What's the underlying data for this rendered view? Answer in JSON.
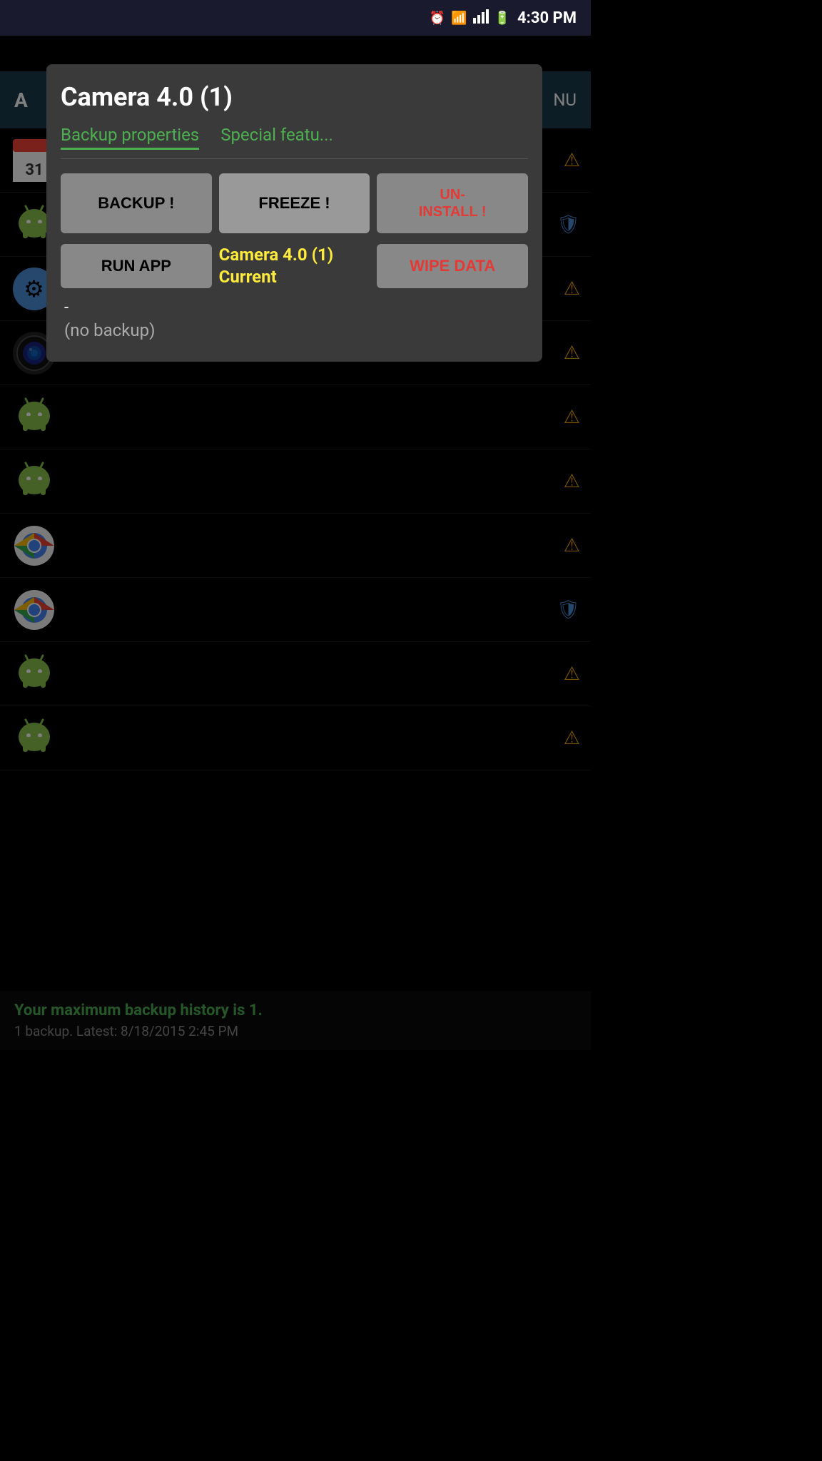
{
  "statusBar": {
    "time": "4:30 PM",
    "icons": [
      "alarm",
      "wifi",
      "signal",
      "battery"
    ]
  },
  "topBar": {
    "leftLabel": "A",
    "rightLabel": "NU"
  },
  "modal": {
    "title": "Camera 4.0 (1)",
    "tabs": [
      {
        "label": "Backup properties",
        "active": true
      },
      {
        "label": "Special featu...",
        "active": false
      }
    ],
    "buttons": {
      "backup": "BACKUP !",
      "freeze": "FREEZE !",
      "uninstall": "UN-\nINSTALL !",
      "runApp": "RUN APP",
      "wipeData": "WIPE DATA"
    },
    "appInfo": {
      "currentLabel": "Camera 4.0 (1)",
      "currentSublabel": "Current"
    },
    "backupInfo": {
      "dash": "-",
      "status": "(no backup)"
    }
  },
  "appList": {
    "rows": [
      {
        "iconType": "calendar",
        "warning": true
      },
      {
        "iconType": "android-green",
        "warning": false,
        "shield": true
      },
      {
        "iconType": "gear",
        "warning": true
      },
      {
        "iconType": "camera-lens",
        "warning": true
      },
      {
        "iconType": "android-green",
        "warning": true
      },
      {
        "iconType": "android-green",
        "warning": true
      },
      {
        "iconType": "android-green",
        "warning": true
      },
      {
        "iconType": "chrome",
        "warning": true
      },
      {
        "iconType": "chrome-folder",
        "warning": false,
        "shield": true
      },
      {
        "iconType": "android-green",
        "warning": true
      },
      {
        "iconType": "android-green",
        "warning": true
      }
    ]
  },
  "bottomStatus": {
    "line1": "Your maximum backup history is 1.",
    "line2": "1 backup. Latest: 8/18/2015 2:45 PM"
  }
}
